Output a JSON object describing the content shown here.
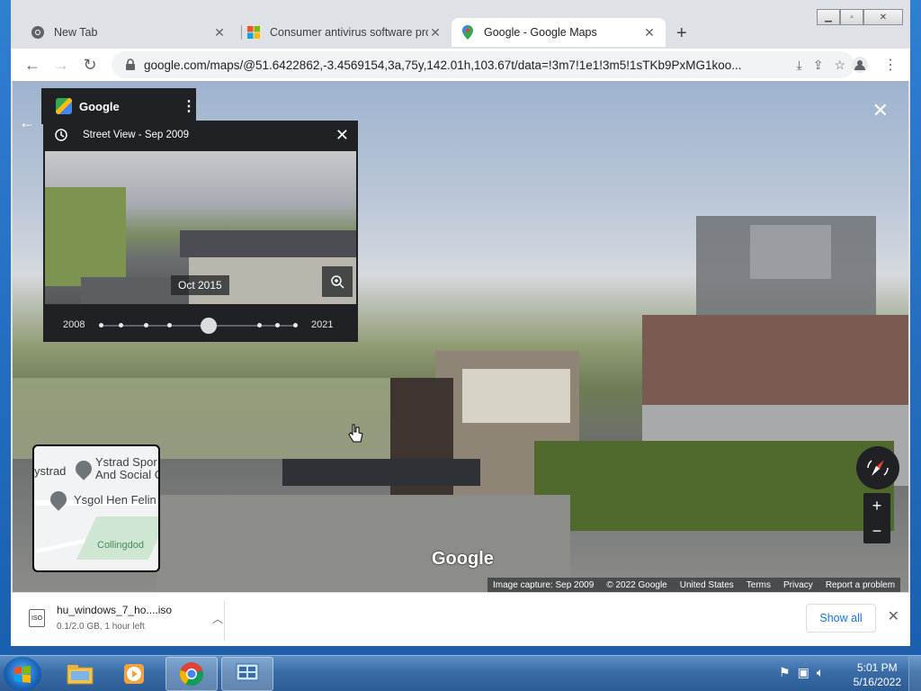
{
  "browser": {
    "tabs": [
      {
        "label": "New Tab",
        "active": false
      },
      {
        "label": "Consumer antivirus software prov",
        "active": false
      },
      {
        "label": "Google - Google Maps",
        "active": true
      }
    ],
    "url": "google.com/maps/@51.6422862,-3.4569154,3a,75y,142.01h,103.67t/data=!3m7!1e1!3m5!1sTKb9PxMG1koo..."
  },
  "panel": {
    "brand": "Google",
    "timeline_title": "Street View - Sep 2009",
    "thumb_label": "Oct 2015",
    "year_start": "2008",
    "year_end": "2021",
    "slider_position_fraction": 0.55
  },
  "minimap": {
    "place1_line1": "Ystrad Spor",
    "place1_line2": "And Social C",
    "place_left": "ystrad",
    "place2": "Ysgol Hen Felin",
    "place3": "Collingdod"
  },
  "map": {
    "watermark": "Google",
    "footer": {
      "capture": "Image capture: Sep 2009",
      "copyright": "© 2022 Google",
      "region": "United States",
      "terms": "Terms",
      "privacy": "Privacy",
      "report": "Report a problem"
    },
    "zoom_in": "+",
    "zoom_out": "−"
  },
  "downloads": {
    "filename": "hu_windows_7_ho....iso",
    "status": "0.1/2.0 GB, 1 hour left",
    "icon_text": "ISO",
    "show_all": "Show all"
  },
  "taskbar": {
    "time": "5:01 PM",
    "date": "5/16/2022"
  },
  "colors": {
    "accent": "#1a73e8",
    "panel_bg": "#202124",
    "taskbar": "#3a6da7"
  }
}
